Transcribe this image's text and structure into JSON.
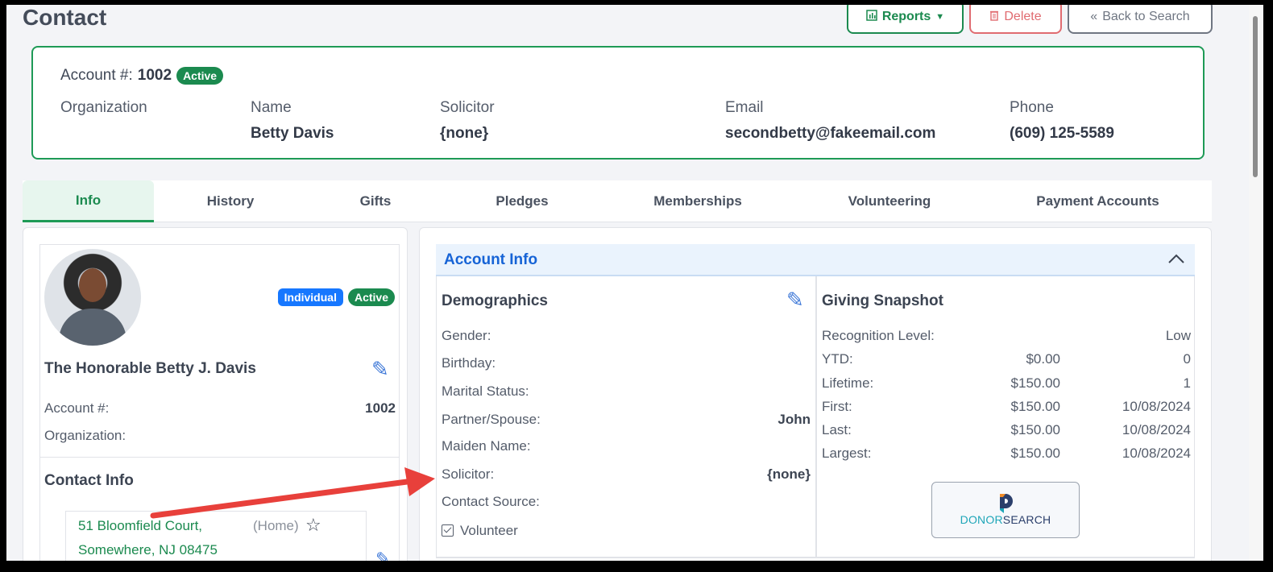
{
  "page": {
    "title": "Contact"
  },
  "toolbar": {
    "reports_label": "Reports",
    "delete_label": "Delete",
    "back_label": "Back to Search"
  },
  "summary": {
    "account_label": "Account #:",
    "account_number": "1002",
    "status": "Active",
    "organization_label": "Organization",
    "organization_value": "",
    "name_label": "Name",
    "name_value": "Betty Davis",
    "solicitor_label": "Solicitor",
    "solicitor_value": "{none}",
    "email_label": "Email",
    "email_value": "secondbetty@fakeemail.com",
    "phone_label": "Phone",
    "phone_value": "(609) 125-5589"
  },
  "tabs": [
    "Info",
    "History",
    "Gifts",
    "Pledges",
    "Memberships",
    "Volunteering",
    "Payment Accounts"
  ],
  "profile": {
    "type_badge": "Individual",
    "status_badge": "Active",
    "full_name": "The Honorable Betty J. Davis",
    "account_label": "Account #:",
    "account_value": "1002",
    "organization_label": "Organization:",
    "organization_value": "",
    "contact_info_title": "Contact Info",
    "address_line1": "51 Bloomfield Court,",
    "address_line2": "Somewhere, NJ 08475",
    "address_type": "(Home)"
  },
  "account_info": {
    "title": "Account Info",
    "demographics": {
      "title": "Demographics",
      "gender_label": "Gender:",
      "birthday_label": "Birthday:",
      "marital_label": "Marital Status:",
      "partner_label": "Partner/Spouse:",
      "partner_value": "John",
      "maiden_label": "Maiden Name:",
      "solicitor_label": "Solicitor:",
      "solicitor_value": "{none}",
      "source_label": "Contact Source:",
      "volunteer_label": "Volunteer"
    },
    "giving": {
      "title": "Giving Snapshot",
      "recognition_label": "Recognition Level:",
      "recognition_value": "Low",
      "rows": [
        {
          "label": "YTD:",
          "amount": "$0.00",
          "count": "0"
        },
        {
          "label": "Lifetime:",
          "amount": "$150.00",
          "count": "1"
        },
        {
          "label": "First:",
          "amount": "$150.00",
          "count": "10/08/2024"
        },
        {
          "label": "Last:",
          "amount": "$150.00",
          "count": "10/08/2024"
        },
        {
          "label": "Largest:",
          "amount": "$150.00",
          "count": "10/08/2024"
        }
      ],
      "donor_search_a": "DONOR",
      "donor_search_b": "SEARCH"
    }
  },
  "colors": {
    "brand_green": "#1b8a4f",
    "accent_blue": "#1663d6",
    "danger": "#e06b70",
    "annotation_red": "#e8403b"
  }
}
